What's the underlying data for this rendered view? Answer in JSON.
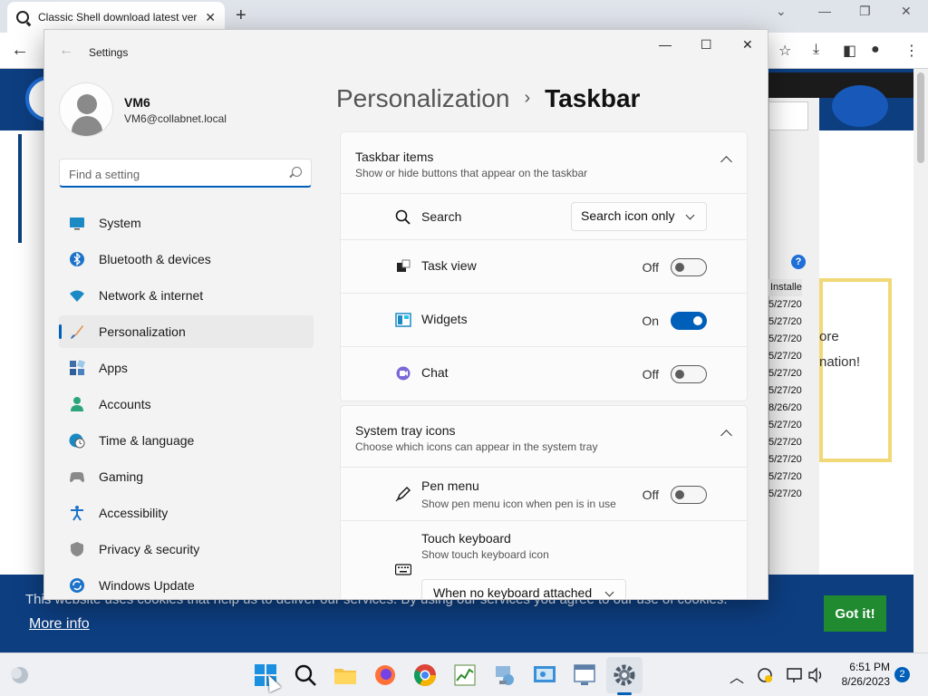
{
  "browser": {
    "tab_title": "Classic Shell download latest ver",
    "tab_close": "✕",
    "new_tab": "+"
  },
  "website": {
    "cookie_text": "This website uses cookies that help us to deliver our services. By using our services you agree to our use of cookies.",
    "more_info": "More info",
    "got_it": "Got it!",
    "column_header": "Installe",
    "column_dates": [
      "5/27/20",
      "5/27/20",
      "5/27/20",
      "5/27/20",
      "5/27/20",
      "5/27/20",
      "8/26/20",
      "5/27/20",
      "5/27/20",
      "5/27/20",
      "5/27/20",
      "5/27/20"
    ],
    "promo_text_1": "ore",
    "promo_text_2": "nation!",
    "help": "?"
  },
  "settings": {
    "app_title": "Settings",
    "user": {
      "name": "VM6",
      "email": "VM6@collabnet.local"
    },
    "search_placeholder": "Find a setting",
    "nav": [
      {
        "label": "System",
        "icon": "monitor-icon"
      },
      {
        "label": "Bluetooth & devices",
        "icon": "bluetooth-icon"
      },
      {
        "label": "Network & internet",
        "icon": "wifi-icon"
      },
      {
        "label": "Personalization",
        "icon": "brush-icon",
        "active": true
      },
      {
        "label": "Apps",
        "icon": "apps-icon"
      },
      {
        "label": "Accounts",
        "icon": "person-icon"
      },
      {
        "label": "Time & language",
        "icon": "globe-clock-icon"
      },
      {
        "label": "Gaming",
        "icon": "gamepad-icon"
      },
      {
        "label": "Accessibility",
        "icon": "accessibility-icon"
      },
      {
        "label": "Privacy & security",
        "icon": "shield-icon"
      },
      {
        "label": "Windows Update",
        "icon": "update-icon"
      }
    ],
    "breadcrumb": {
      "parent": "Personalization",
      "separator": "›",
      "current": "Taskbar"
    },
    "taskbar_items": {
      "title": "Taskbar items",
      "subtitle": "Show or hide buttons that appear on the taskbar",
      "search": {
        "label": "Search",
        "value": "Search icon only"
      },
      "task_view": {
        "label": "Task view",
        "state": "Off"
      },
      "widgets": {
        "label": "Widgets",
        "state": "On"
      },
      "chat": {
        "label": "Chat",
        "state": "Off"
      }
    },
    "system_tray": {
      "title": "System tray icons",
      "subtitle": "Choose which icons can appear in the system tray",
      "pen_menu": {
        "label": "Pen menu",
        "sub": "Show pen menu icon when pen is in use",
        "state": "Off"
      },
      "touch_keyboard": {
        "label": "Touch keyboard",
        "sub": "Show touch keyboard icon",
        "value": "When no keyboard attached"
      }
    }
  },
  "taskbar": {
    "time": "6:51 PM",
    "date": "8/26/2023",
    "notifications": "2"
  },
  "colors": {
    "accent": "#005fb8",
    "site_blue": "#0d3e80",
    "got_it_green": "#1f8a2f"
  }
}
